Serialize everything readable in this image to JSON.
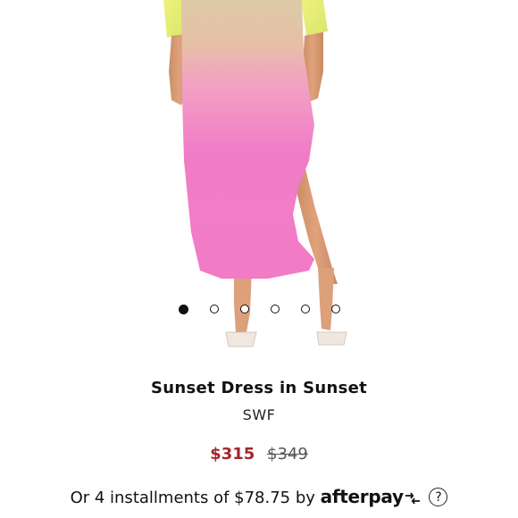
{
  "product": {
    "name": "Sunset Dress in Sunset",
    "brand": "SWF",
    "sale_price": "$315",
    "original_price": "$349"
  },
  "carousel": {
    "total": 6,
    "active_index": 0
  },
  "installments": {
    "text": "Or 4 installments of $78.75 by",
    "provider": "afterpay",
    "help_label": "?"
  },
  "colors": {
    "sale_price": "#a3262c",
    "dress_top": "#d9c9a3",
    "dress_bottom": "#f06fc0",
    "sleeve": "#e8f07a"
  },
  "icons": {
    "afterpay_arrows": "afterpay-arrows-icon",
    "help": "help-icon"
  }
}
